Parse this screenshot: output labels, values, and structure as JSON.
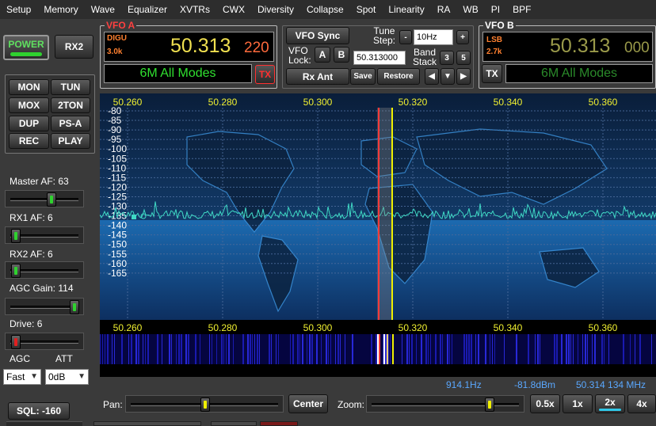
{
  "menu": [
    "Setup",
    "Memory",
    "Wave",
    "Equalizer",
    "XVTRs",
    "CWX",
    "Diversity",
    "Collapse",
    "Spot",
    "Linearity",
    "RA",
    "WB",
    "PI",
    "BPF"
  ],
  "left_buttons": {
    "power": "POWER",
    "rx2": "RX2",
    "mon": "MON",
    "tun": "TUN",
    "mox": "MOX",
    "twotone": "2TON",
    "dup": "DUP",
    "psa": "PS-A",
    "rec": "REC",
    "play": "PLAY"
  },
  "sliders": {
    "master_af": {
      "label": "Master AF:",
      "value": "63",
      "level": 0.6
    },
    "rx1_af": {
      "label": "RX1 AF:",
      "value": "6",
      "level": 0.06
    },
    "rx2_af": {
      "label": "RX2 AF:",
      "value": "6",
      "level": 0.06
    },
    "agc_gain": {
      "label": "AGC Gain:",
      "value": "114",
      "level": 0.94
    },
    "drive": {
      "label": "Drive:",
      "value": "6",
      "level": 0.06
    }
  },
  "agc": {
    "label": "AGC",
    "value": "Fast"
  },
  "att": {
    "label": "ATT",
    "value": "0dB"
  },
  "sql": {
    "label": "SQL:",
    "value": "-160"
  },
  "vfo_a": {
    "title": "VFO A",
    "mode": "DIGU",
    "filter": "3.0k",
    "freq_main": "50.313",
    "freq_sub": "220",
    "band": "6M All Modes",
    "tx": "TX"
  },
  "vfo_b": {
    "title": "VFO B",
    "mode": "LSB",
    "filter": "2.7k",
    "freq_main": "50.313",
    "freq_sub": "000",
    "band": "6M All Modes",
    "tx": "TX"
  },
  "center": {
    "vfo_sync": "VFO Sync",
    "tune_step_label": "Tune Step:",
    "tune_step_value": "10Hz",
    "minus": "-",
    "plus": "+",
    "vfo_lock_label": "VFO Lock:",
    "lock_a": "A",
    "lock_b": "B",
    "freq_entry": "50.313000",
    "band_stack_label": "Band Stack",
    "bs_3": "3",
    "bs_5": "5",
    "rx_ant": "Rx Ant",
    "save": "Save",
    "restore": "Restore",
    "arrow_left": "◀",
    "arrow_down": "▼",
    "arrow_right": "▶"
  },
  "spectrum": {
    "freq_labels": [
      "50.260",
      "50.280",
      "50.300",
      "50.320",
      "50.340",
      "50.360"
    ],
    "db_labels": [
      "-80",
      "-85",
      "-90",
      "-95",
      "-100",
      "-105",
      "-110",
      "-115",
      "-120",
      "-125",
      "-130",
      "-135",
      "-140",
      "-145",
      "-150",
      "-155",
      "-160",
      "-165"
    ],
    "grid_color": "#4a6a9a",
    "trace_color": "#3fd9c5"
  },
  "status": {
    "cursor_offset": "914.1Hz",
    "cursor_level": "-81.8dBm",
    "cursor_freq": "50.314 134 MHz"
  },
  "bottom": {
    "pan_label": "Pan:",
    "center": "Center",
    "zoom_label": "Zoom:",
    "pan_level": 0.5,
    "zoom_level": 0.8,
    "z05": "0.5x",
    "z1": "1x",
    "z2": "2x",
    "z4": "4x"
  },
  "colors": {
    "vfo_freq": "#f0e050",
    "vfo_sub": "#ff6a3c",
    "vfo_b_freq": "#9a9a4a",
    "band_text": "#30e030",
    "vfo_title": "#ff4040"
  }
}
